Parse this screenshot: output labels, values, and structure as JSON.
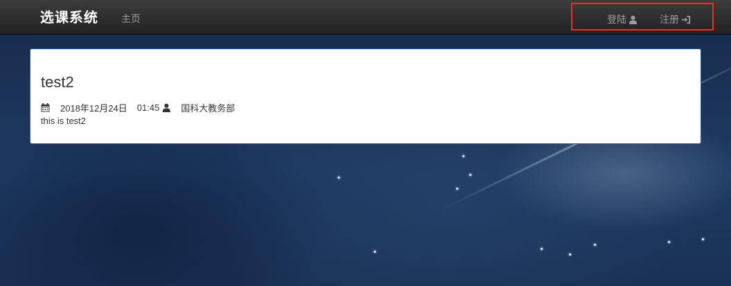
{
  "navbar": {
    "brand": "选课系统",
    "home_label": "主页",
    "login_label": "登陆",
    "register_label": "注册",
    "login_icon": "user-icon",
    "register_icon": "log-in-icon"
  },
  "post": {
    "title": "test2",
    "date": "2018年12月24日",
    "time": "01:45",
    "author": "国科大教务部",
    "body": "this is test2",
    "date_icon": "calendar-icon",
    "author_icon": "user-icon"
  },
  "colors": {
    "navbar_bg": "#222222",
    "highlight_box": "#e0362b",
    "card_border": "#2c5d99",
    "nav_text": "#9d9d9d"
  }
}
